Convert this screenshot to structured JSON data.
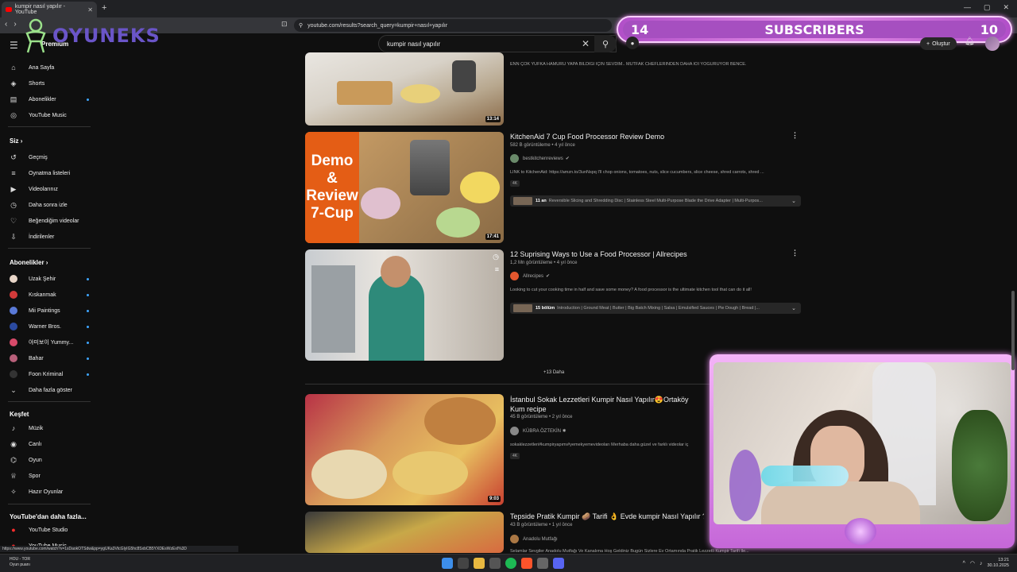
{
  "browser": {
    "tab_title": "kumpir nasıl yapılır - YouTube",
    "url": "youtube.com/results?search_query=kumpir+nasıl+yapılır"
  },
  "overlay": {
    "brand": "OYUNEKS",
    "subs_left": "14",
    "subs_label": "SUBSCRIBERS",
    "subs_right": "10"
  },
  "youtube": {
    "brand": "Premium",
    "search_value": "kumpir nasıl yapılır",
    "create_label": "Oluştur"
  },
  "sidebar": {
    "main": [
      "Ana Sayfa",
      "Shorts",
      "Abonelikler",
      "YouTube Music"
    ],
    "you_header": "Siz",
    "you": [
      "Geçmiş",
      "Oynatma listeleri",
      "Videolarınız",
      "Daha sonra izle",
      "Beğendiğim videolar",
      "İndirilenler"
    ],
    "subs_header": "Abonelikler",
    "subs": [
      {
        "name": "Uzak Şehir",
        "color": "#e8d6c8"
      },
      {
        "name": "Kıskanmak",
        "color": "#d23a3a"
      },
      {
        "name": "Mii Paintings",
        "color": "#5a7ad8"
      },
      {
        "name": "Warner Bros.",
        "color": "#2b4aa0"
      },
      {
        "name": "야미보이 Yummy...",
        "color": "#d84a6a"
      },
      {
        "name": "Bahar",
        "color": "#b8607a"
      },
      {
        "name": "Foon Kriminal",
        "color": "#333333"
      }
    ],
    "show_more": "Daha fazla göster",
    "explore_header": "Keşfet",
    "explore": [
      "Müzik",
      "Canlı",
      "Oyun",
      "Spor",
      "Hazır Oyunlar"
    ],
    "more_header": "YouTube'dan daha fazla...",
    "more": [
      "YouTube Studio",
      "YouTube Music"
    ]
  },
  "videos": [
    {
      "duration": "13:14",
      "desc": "ENN ÇOK YUFKA HAMURU YAPA BİLDİĞİ İÇİN SEVDİM.. MUTFAK CHEFLERİNDEN DAHA İÖİ YOĞURUYOR BENCE."
    },
    {
      "title": "KitchenAid 7 Cup Food Processor Review Demo",
      "meta": "582 B görüntüleme • 4 yıl önce",
      "channel": "bestkitchenreviews",
      "desc": "LINK to KitchenAid: https://amzn.to/3unNspq I'll chop onions, tomatoes, nuts, slice cucumbers, slice cheese, shred carrots, shred ...",
      "badge": "4K",
      "chap_bold": "11 an",
      "chap_text": "Reversible Slicing and Shredding Disc | Stainless Steel Multi-Purpose Blade the Drive Adapter | Multi-Purpos...",
      "duration": "17:41",
      "thumb_text": [
        "Demo",
        "&",
        "Review",
        "7-Cup"
      ]
    },
    {
      "title": "12 Suprising Ways to Use a Food Processor | Allrecipes",
      "meta": "1,2 Mn görüntüleme • 4 yıl önce",
      "channel": "Allrecipes",
      "desc": "Looking to cut your cooking time in half and save some money? A food processor is the ultimate kitchen tool that can do it all!",
      "chap_bold": "15 bölüm",
      "chap_text": "Introduction | Ground Meat | Butter | Big Batch Mixing | Salsa | Emulsified Sauces | Pie Dough | Bread |..."
    },
    {
      "title": "İstanbul Sokak Lezzetleri Kumpir Nasıl Yapılır😍Ortaköy Kum recipe",
      "meta": "45 B görüntüleme • 2 yıl önce",
      "channel": "KÜBRA ÖZTEKİN ✸",
      "desc": "sokaklezzetleri#kumpiryapımı#yemekyemevideoları Merhaba daha güzel ve farklı videolar iç",
      "badge": "4K",
      "duration": "9:03"
    },
    {
      "title": "Tepside Pratik Kumpir 🥔 Tarifi 👌 Evde kumpir Nasıl Yapılır ?",
      "meta": "43 B görüntüleme • 1 yıl önce",
      "channel": "Anadolu Mutfağı",
      "desc": "Selamlar Sevgiler Anadolu Mutfağı Ve Kanalıma Hoş Geldiniz Bugün Sizlere Ev Ortamında Pratik Lezzetli Kumpir Tarifi İle..."
    }
  ],
  "more_label": "+13 Daha",
  "status_url": "https://www.youtube.com/watch?v=1sDaokOTSdw&pp=ygUKa3VtcGlyIG5hc8SxbCB5YXDEsWzExI%3D",
  "taskbar": {
    "weather_1": "HOU - TOR",
    "weather_2": "Oyun puanı",
    "time": "13:21",
    "date": "30.10.2025"
  }
}
